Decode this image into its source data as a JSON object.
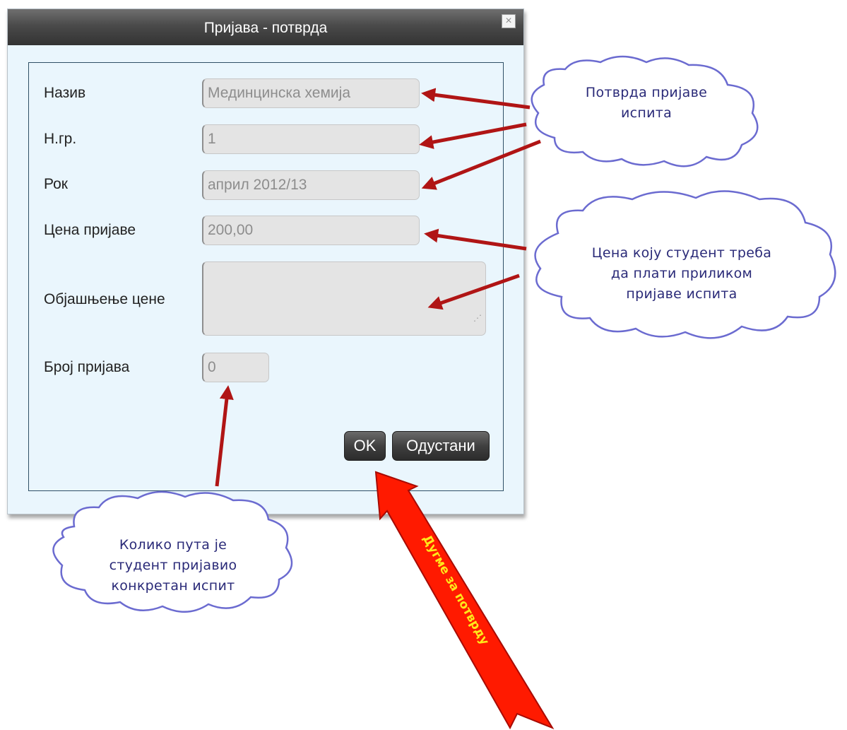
{
  "dialog": {
    "title": "Пријава - потврда",
    "close_icon": "×"
  },
  "form": {
    "fields": [
      {
        "label": "Назив",
        "value": "Мединцинска хемија"
      },
      {
        "label": "Н.гр.",
        "value": "1"
      },
      {
        "label": "Рок",
        "value": "април 2012/13"
      },
      {
        "label": "Цена пријаве",
        "value": "200,00"
      },
      {
        "label": "Објашњење цене",
        "value": ""
      },
      {
        "label": "Број пријава",
        "value": "0"
      }
    ],
    "ok_label": "OK",
    "cancel_label": "Одустани"
  },
  "annotations": {
    "confirm_line1": "Потврда пријаве",
    "confirm_line2": "испита",
    "price_line1": "Цена коју студент треба",
    "price_line2": "да плати приликом",
    "price_line3": "пријаве испита",
    "count_line1": "Колико пута је",
    "count_line2": "студент пријавио",
    "count_line3": "конкретан испит",
    "big_arrow_label": "Дугме за потврду"
  },
  "colors": {
    "dialog_bg": "#eaf6fd",
    "titlebar": "#3c3c3c",
    "arrow": "#b01515",
    "cloud_stroke": "#6b6bd0",
    "big_arrow": "#ff1a00",
    "big_arrow_text": "#ffe81a"
  }
}
